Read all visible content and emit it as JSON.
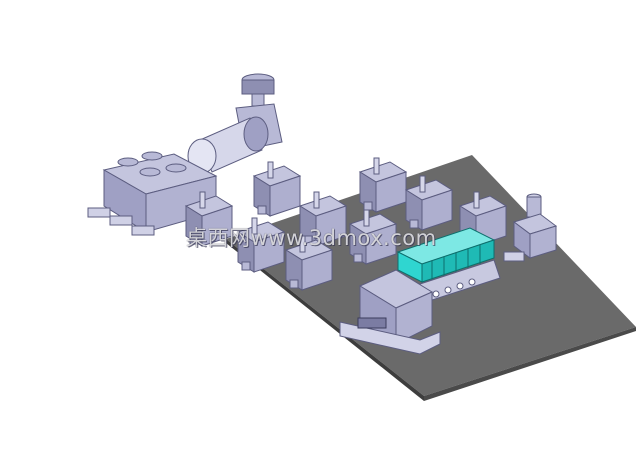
{
  "scene": {
    "subject": "3D model render of pneumatic components laid out on a grey base plate",
    "colors": {
      "background": "#ffffff",
      "plate_top": "#6b6b6b",
      "plate_edge": "#3d3d3d",
      "part": "#b8b9d6",
      "part_shade": "#8e8fb2",
      "part_dark": "#5c5d80",
      "highlight": "#2fd6d0",
      "highlight_dark": "#139a98"
    },
    "components": [
      {
        "name": "regulator-assembly"
      },
      {
        "name": "filter-housing"
      },
      {
        "name": "manifold-block"
      },
      {
        "name": "fitting-row"
      },
      {
        "name": "solenoid-valve-1"
      },
      {
        "name": "solenoid-valve-2"
      },
      {
        "name": "solenoid-valve-3"
      },
      {
        "name": "solenoid-valve-4"
      },
      {
        "name": "solenoid-valve-5"
      },
      {
        "name": "solenoid-valve-6"
      },
      {
        "name": "solenoid-valve-7"
      },
      {
        "name": "solenoid-valve-8"
      },
      {
        "name": "solenoid-valve-9"
      },
      {
        "name": "valve-manifold-highlighted"
      },
      {
        "name": "terminal-box"
      },
      {
        "name": "pressure-switch"
      }
    ]
  },
  "watermark": {
    "text": "桌西网www.3dmox.com"
  }
}
